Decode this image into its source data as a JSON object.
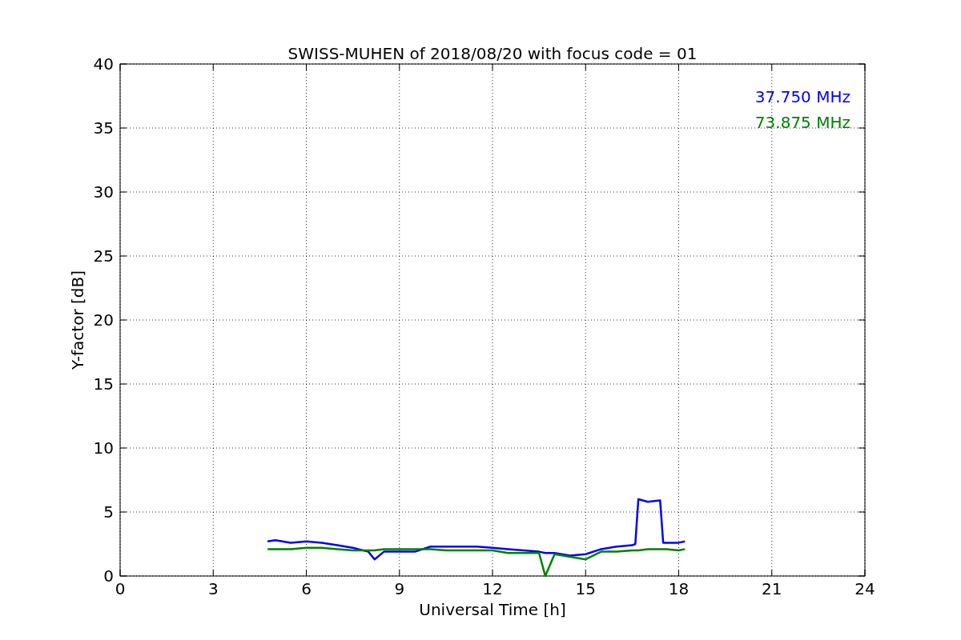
{
  "chart_data": {
    "type": "line",
    "title": "SWISS-MUHEN of 2018/08/20 with focus code = 01",
    "xlabel": "Universal Time [h]",
    "ylabel": "Y-factor [dB]",
    "x": [
      4.75,
      5,
      5.5,
      6,
      6.5,
      7,
      7.5,
      8,
      8.2,
      8.5,
      9,
      9.5,
      10,
      10.5,
      11,
      11.5,
      12,
      12.5,
      13,
      13.5,
      13.7,
      14,
      14.5,
      15,
      15.5,
      16,
      16.5,
      16.6,
      16.7,
      17,
      17.4,
      17.5,
      17.6,
      18,
      18.2
    ],
    "series": [
      {
        "name": "37.750 MHz",
        "color": "#0000ff",
        "values": [
          2.7,
          2.8,
          2.6,
          2.7,
          2.6,
          2.4,
          2.2,
          1.9,
          1.3,
          1.9,
          1.9,
          1.9,
          2.3,
          2.3,
          2.3,
          2.3,
          2.2,
          2.1,
          2.0,
          1.9,
          1.8,
          1.8,
          1.6,
          1.7,
          2.1,
          2.3,
          2.4,
          2.5,
          6.0,
          5.8,
          5.9,
          2.6,
          2.6,
          2.6,
          2.7
        ]
      },
      {
        "name": "73.875 MHz",
        "color": "#008000",
        "values": [
          2.1,
          2.1,
          2.1,
          2.2,
          2.2,
          2.1,
          2.0,
          2.0,
          2.0,
          2.1,
          2.1,
          2.1,
          2.1,
          2.0,
          2.0,
          2.0,
          2.0,
          1.8,
          1.8,
          1.8,
          0.0,
          1.7,
          1.5,
          1.3,
          1.9,
          1.9,
          2.0,
          2.0,
          2.0,
          2.1,
          2.1,
          2.1,
          2.1,
          2.0,
          2.1
        ]
      }
    ],
    "grid": true,
    "xlim": [
      0,
      24
    ],
    "ylim": [
      0,
      40
    ],
    "xticks": [
      0,
      3,
      6,
      9,
      12,
      15,
      18,
      21,
      24
    ],
    "yticks": [
      0,
      5,
      10,
      15,
      20,
      25,
      30,
      35,
      40
    ]
  }
}
